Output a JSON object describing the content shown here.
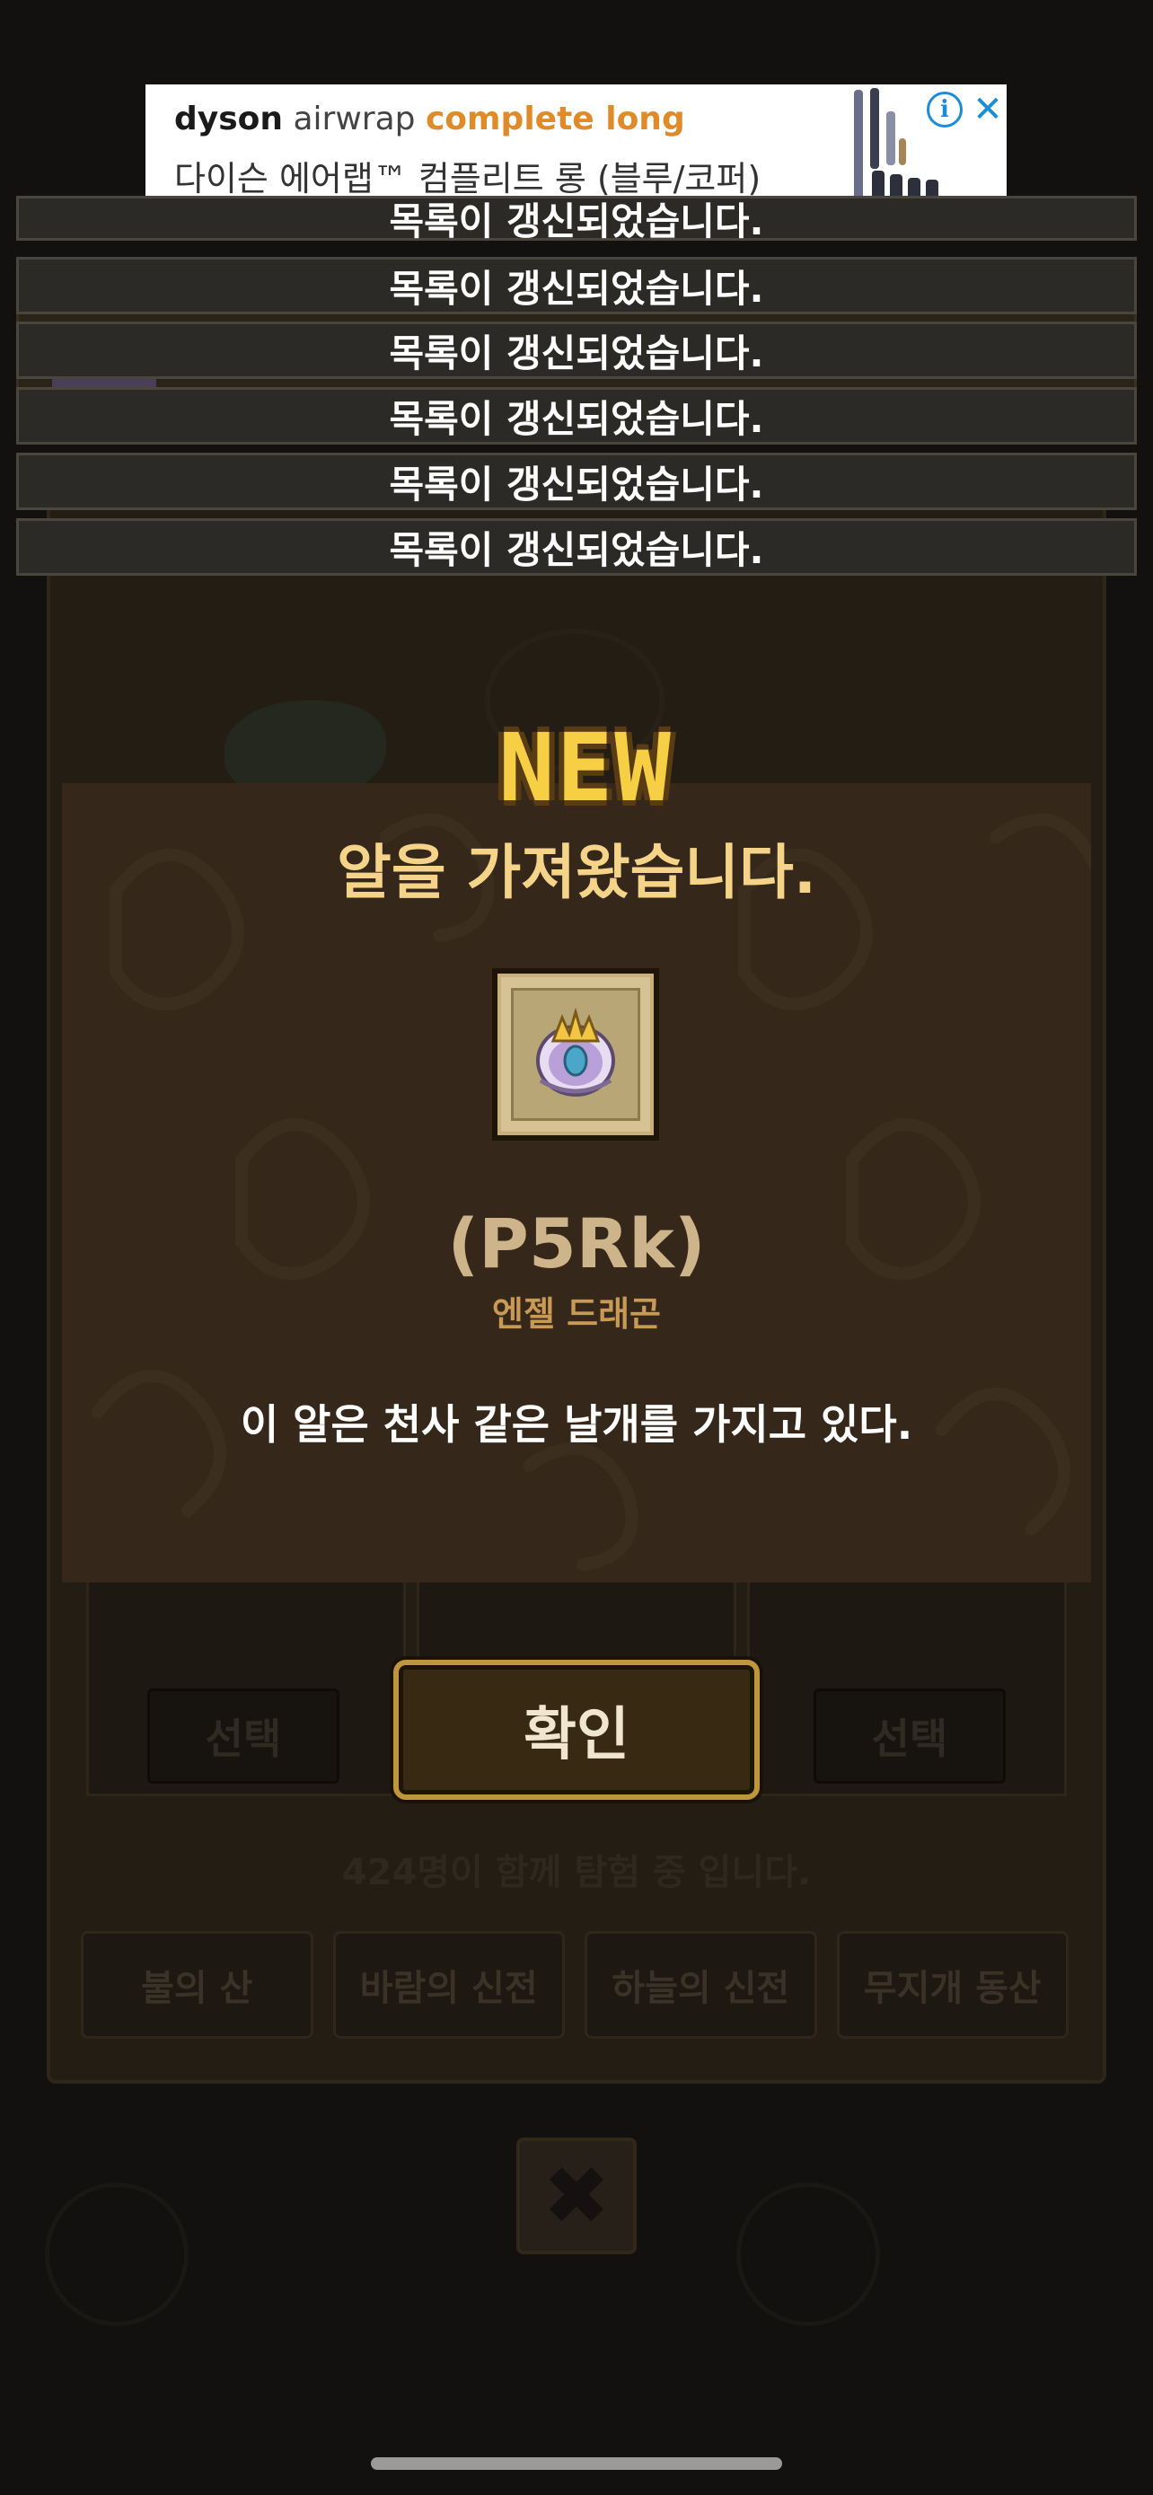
{
  "ad": {
    "brand_name": "dyson",
    "brand_product": "airwrap",
    "brand_model": "complete long",
    "subtitle": "다이슨 에어랩™ 컴플리트 롱 (블루/코퍼)",
    "info_icon": "info-icon",
    "close_icon": "close-icon"
  },
  "toasts": [
    "목록이 갱신되었습니다.",
    "목록이 갱신되었습니다.",
    "목록이 갱신되었습니다.",
    "목록이 갱신되었습니다.",
    "목록이 갱신되었습니다.",
    "목록이 갱신되었습니다."
  ],
  "modal": {
    "badge": "NEW",
    "heading": "알을 가져왔습니다.",
    "egg_icon": "dragon-egg-icon",
    "egg_code": "(P5Rk)",
    "egg_name": "엔젤 드래곤",
    "description": "이 알은 천사 같은 날개를 가지고 있다.",
    "confirm_label": "확인"
  },
  "background": {
    "select_label_left": "선택",
    "select_label_right": "선택",
    "online_text": "424명이 함께 탐험 중 입니다.",
    "tabs": [
      "불의 산",
      "바람의 신전",
      "하늘의 신전",
      "무지개 동산"
    ],
    "close_icon": "close-x-icon"
  },
  "colors": {
    "heading": "#f5d48a",
    "badge": "#f6cf44",
    "egg_code": "#cdb48a",
    "egg_name": "#c99a55",
    "confirm_border": "#c0963c",
    "ad_accent": "#1b8dd6"
  }
}
